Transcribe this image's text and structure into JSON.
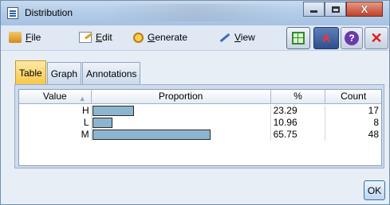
{
  "window": {
    "title": "Distribution",
    "controls": {
      "minimize_icon": "minimize-icon",
      "maximize_icon": "maximize-icon",
      "close_glyph": "X"
    }
  },
  "menu": {
    "items": [
      {
        "label": "File",
        "mnemonic": "F",
        "rest": "ile",
        "icon": "folder-icon"
      },
      {
        "label": "Edit",
        "mnemonic": "E",
        "rest": "dit",
        "icon": "edit-icon"
      },
      {
        "label": "Generate",
        "mnemonic": "G",
        "rest": "enerate",
        "icon": "generate-icon"
      },
      {
        "label": "View",
        "mnemonic": "V",
        "rest": "iew",
        "icon": "view-icon"
      }
    ],
    "toolbar": {
      "export_icon": "table-export-icon",
      "chart_icon": "chart-icon",
      "chart_glyph": "A",
      "help_glyph": "?",
      "close_glyph": "✕"
    }
  },
  "tabs": [
    {
      "label": "Table",
      "active": true
    },
    {
      "label": "Graph",
      "active": false
    },
    {
      "label": "Annotations",
      "active": false
    }
  ],
  "table": {
    "columns": [
      "Value",
      "Proportion",
      "%",
      "Count"
    ],
    "sort_indicator": "▲",
    "rows": [
      {
        "value": "H",
        "percent": "23.29",
        "count": "17",
        "proportion": 0.2329
      },
      {
        "value": "L",
        "percent": "10.96",
        "count": "8",
        "proportion": 0.1096
      },
      {
        "value": "M",
        "percent": "65.75",
        "count": "48",
        "proportion": 0.6575
      }
    ],
    "bar_color": "#8eb5cf"
  },
  "buttons": {
    "ok": "OK"
  }
}
